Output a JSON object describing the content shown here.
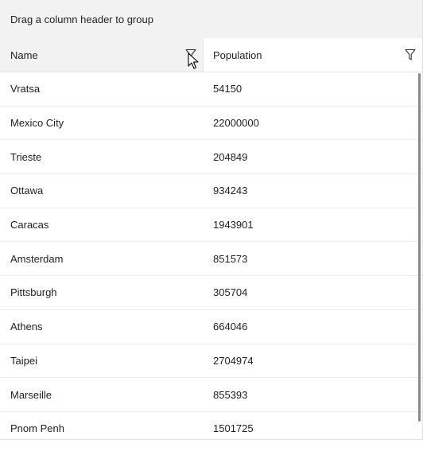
{
  "group_panel": {
    "hint": "Drag a column header to group"
  },
  "columns": [
    {
      "header": "Name",
      "icon": "filter-icon"
    },
    {
      "header": "Population",
      "icon": "filter-icon"
    }
  ],
  "rows": [
    {
      "name": "Vratsa",
      "population": "54150"
    },
    {
      "name": "Mexico City",
      "population": "22000000"
    },
    {
      "name": "Trieste",
      "population": "204849"
    },
    {
      "name": "Ottawa",
      "population": "934243"
    },
    {
      "name": "Caracas",
      "population": "1943901"
    },
    {
      "name": "Amsterdam",
      "population": "851573"
    },
    {
      "name": "Pittsburgh",
      "population": "305704"
    },
    {
      "name": "Athens",
      "population": "664046"
    },
    {
      "name": "Taipei",
      "population": "2704974"
    },
    {
      "name": "Marseille",
      "population": "855393"
    },
    {
      "name": "Pnom Penh",
      "population": "1501725"
    }
  ],
  "colors": {
    "header_hover": "#f2f2f2",
    "group_panel_bg": "#f2f2f2",
    "row_divider": "#ededed",
    "scrollbar": "#8a8a8a"
  }
}
